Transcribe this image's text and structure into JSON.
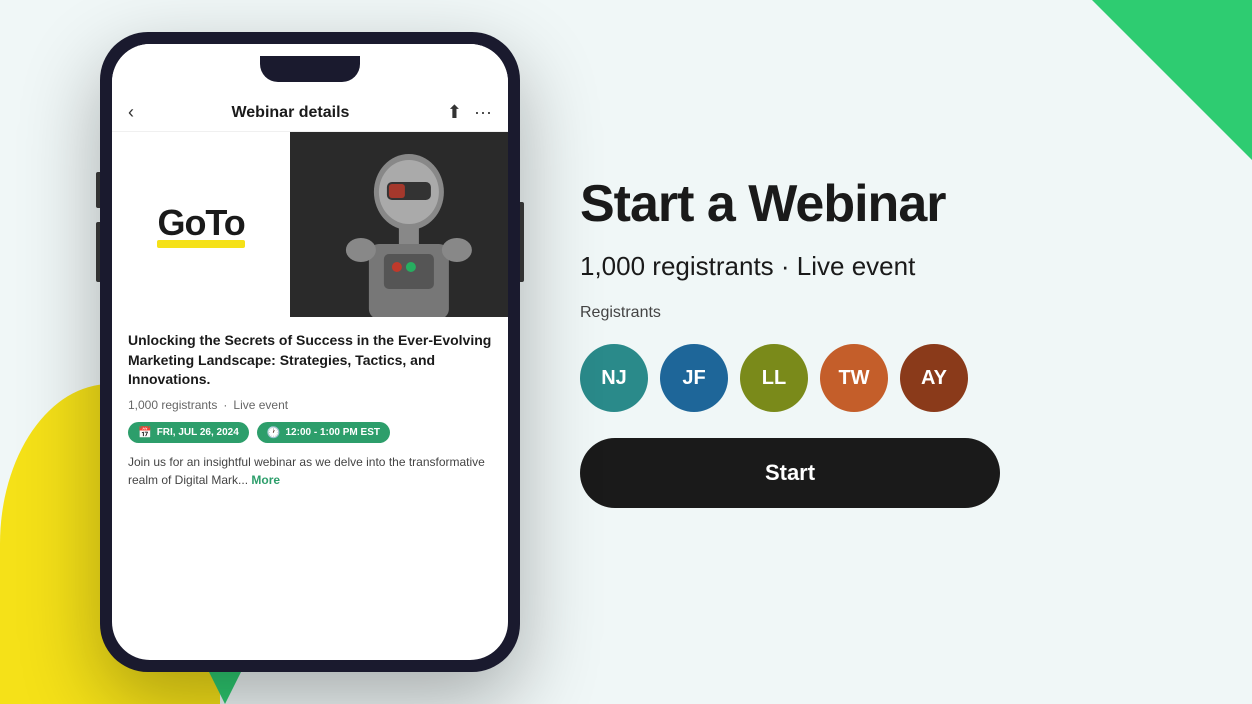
{
  "page": {
    "background": "#f0f7f7"
  },
  "phone": {
    "nav_back_label": "‹",
    "nav_title": "Webinar details",
    "nav_upload_icon": "↑",
    "nav_more_icon": "•••",
    "logo_text": "GoTo",
    "webinar_title": "Unlocking the Secrets of Success in the Ever-Evolving Marketing Landscape: Strategies, Tactics, and Innovations.",
    "registrants_count": "1,000 registrants",
    "dot_separator": "·",
    "event_type": "Live event",
    "date_badge": "FRI, JUL 26, 2024",
    "time_badge": "12:00 - 1:00 PM EST",
    "description": "Join us for an insightful webinar as we delve into the transformative realm of Digital Mark...",
    "more_text": "More"
  },
  "right_panel": {
    "headline": "Start a Webinar",
    "subheadline": "1,000 registrants · Live event",
    "registrants_label": "Registrants",
    "avatars": [
      {
        "initials": "NJ",
        "color_class": "avatar-nj"
      },
      {
        "initials": "JF",
        "color_class": "avatar-jf"
      },
      {
        "initials": "LL",
        "color_class": "avatar-ll"
      },
      {
        "initials": "TW",
        "color_class": "avatar-tw"
      },
      {
        "initials": "AY",
        "color_class": "avatar-ay"
      }
    ],
    "start_button": "Start"
  }
}
